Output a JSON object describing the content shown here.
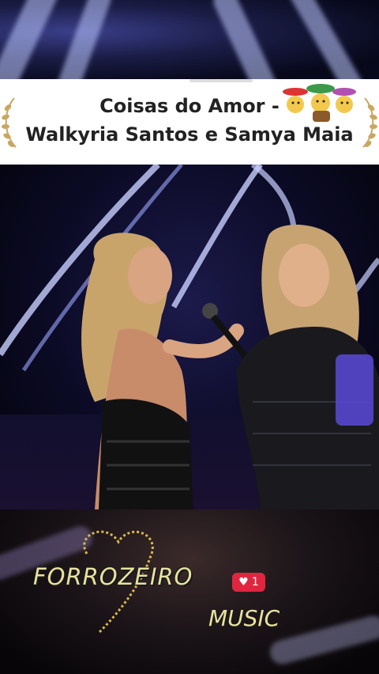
{
  "title_card": {
    "line1": "Coisas do Amor -",
    "line2": "Walkyria Santos e Samya Maia"
  },
  "video": {
    "description_icon": "concert-stage"
  },
  "watermark": {
    "brand": "FORROZEIRO",
    "sub": "MUSIC",
    "badge_count": "1"
  },
  "colors": {
    "title_text": "#222222",
    "watermark_text": "#e9e2a0",
    "badge": "#e0263f",
    "stage_light": "#c8d0ff"
  },
  "icons": {
    "laurel_left": "laurel-icon",
    "laurel_right": "laurel-icon",
    "mariachi": "mariachi-sticker-icon",
    "heart": "heart-icon"
  }
}
